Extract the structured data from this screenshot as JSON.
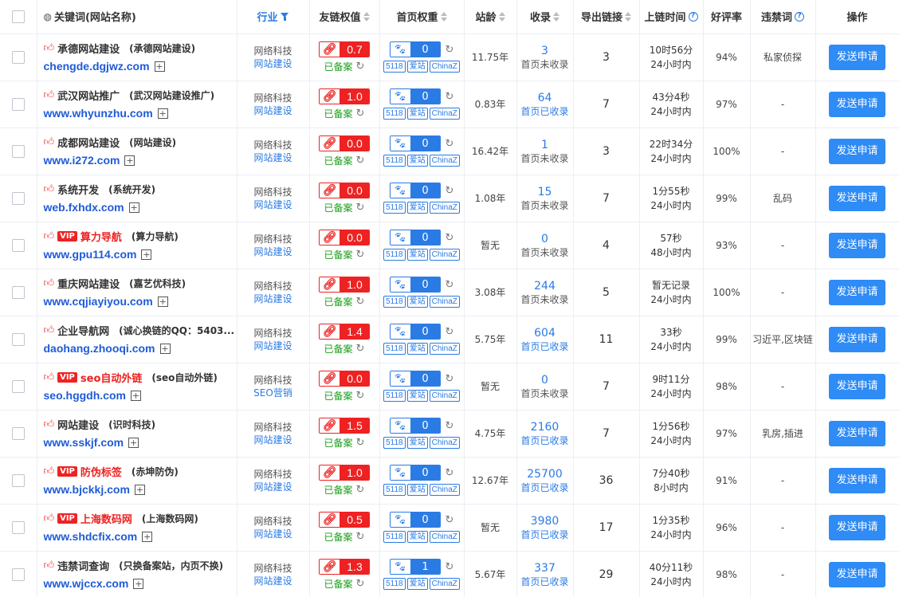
{
  "header": {
    "keyword": "关键词(网站名称)",
    "industry": "行业",
    "pr": "友链权值",
    "weight": "首页权重",
    "age": "站龄",
    "indexed": "收录",
    "outlinks": "导出链接",
    "time": "上链时间",
    "rating": "好评率",
    "banned": "违禁词",
    "action": "操作"
  },
  "labels": {
    "beian": "已备案",
    "tag_5118": "5118",
    "tag_aizhan": "爱站",
    "tag_chinaz": "ChinaZ",
    "vip": "VIP",
    "apply": "发送申请"
  },
  "rows": [
    {
      "kw": "承德网站建设",
      "sub": "(承德网站建设)",
      "vip": false,
      "domain": "chengde.dgjwz.com",
      "ind1": "网络科技",
      "ind2": "网站建设",
      "pr": "0.7",
      "weight": "0",
      "age": "11.75年",
      "sl": "3",
      "sl_status": "首页未收录",
      "sl_ok": false,
      "out": "3",
      "t1": "10时56分",
      "t2": "24小时内",
      "rate": "94%",
      "ban": "私家侦探"
    },
    {
      "kw": "武汉网站推广",
      "sub": "(武汉网站建设推广)",
      "vip": false,
      "domain": "www.whyunzhu.com",
      "ind1": "网络科技",
      "ind2": "网站建设",
      "pr": "1.0",
      "weight": "0",
      "age": "0.83年",
      "sl": "64",
      "sl_status": "首页已收录",
      "sl_ok": true,
      "out": "7",
      "t1": "43分4秒",
      "t2": "24小时内",
      "rate": "97%",
      "ban": "-"
    },
    {
      "kw": "成都网站建设",
      "sub": "(网站建设)",
      "vip": false,
      "domain": "www.i272.com",
      "ind1": "网络科技",
      "ind2": "网站建设",
      "pr": "0.0",
      "weight": "0",
      "age": "16.42年",
      "sl": "1",
      "sl_status": "首页未收录",
      "sl_ok": false,
      "out": "3",
      "t1": "22时34分",
      "t2": "24小时内",
      "rate": "100%",
      "ban": "-"
    },
    {
      "kw": "系统开发",
      "sub": "(系统开发)",
      "vip": false,
      "domain": "web.fxhdx.com",
      "ind1": "网络科技",
      "ind2": "网站建设",
      "pr": "0.0",
      "weight": "0",
      "age": "1.08年",
      "sl": "15",
      "sl_status": "首页未收录",
      "sl_ok": false,
      "out": "7",
      "t1": "1分55秒",
      "t2": "24小时内",
      "rate": "99%",
      "ban": "乱码"
    },
    {
      "kw": "算力导航",
      "sub": "(算力导航)",
      "vip": true,
      "domain": "www.gpu114.com",
      "ind1": "网络科技",
      "ind2": "网站建设",
      "pr": "0.0",
      "weight": "0",
      "age": "暂无",
      "sl": "0",
      "sl_status": "首页未收录",
      "sl_ok": false,
      "out": "4",
      "t1": "57秒",
      "t2": "48小时内",
      "rate": "93%",
      "ban": "-"
    },
    {
      "kw": "重庆网站建设",
      "sub": "(嘉艺优科技)",
      "vip": false,
      "domain": "www.cqjiayiyou.com",
      "ind1": "网络科技",
      "ind2": "网站建设",
      "pr": "1.0",
      "weight": "0",
      "age": "3.08年",
      "sl": "244",
      "sl_status": "首页未收录",
      "sl_ok": false,
      "out": "5",
      "t1": "暂无记录",
      "t2": "24小时内",
      "rate": "100%",
      "ban": "-"
    },
    {
      "kw": "企业导航网",
      "sub": "(诚心换链的QQ：5403...",
      "vip": false,
      "domain": "daohang.zhooqi.com",
      "ind1": "网络科技",
      "ind2": "网站建设",
      "pr": "1.4",
      "weight": "0",
      "age": "5.75年",
      "sl": "604",
      "sl_status": "首页已收录",
      "sl_ok": true,
      "out": "11",
      "t1": "33秒",
      "t2": "24小时内",
      "rate": "99%",
      "ban": "习近平,区块链"
    },
    {
      "kw": "seo自动外链",
      "sub": "(seo自动外链)",
      "vip": true,
      "domain": "seo.hggdh.com",
      "ind1": "网络科技",
      "ind2": "SEO营销",
      "pr": "0.0",
      "weight": "0",
      "age": "暂无",
      "sl": "0",
      "sl_status": "首页未收录",
      "sl_ok": false,
      "out": "7",
      "t1": "9时11分",
      "t2": "24小时内",
      "rate": "98%",
      "ban": "-"
    },
    {
      "kw": "网站建设",
      "sub": "(识时科技)",
      "vip": false,
      "domain": "www.sskjf.com",
      "ind1": "网络科技",
      "ind2": "网站建设",
      "pr": "1.5",
      "weight": "0",
      "age": "4.75年",
      "sl": "2160",
      "sl_status": "首页已收录",
      "sl_ok": true,
      "out": "7",
      "t1": "1分56秒",
      "t2": "24小时内",
      "rate": "97%",
      "ban": "乳房,插进"
    },
    {
      "kw": "防伪标签",
      "sub": "(赤坤防伪)",
      "vip": true,
      "domain": "www.bjckkj.com",
      "ind1": "网络科技",
      "ind2": "网站建设",
      "pr": "1.0",
      "weight": "0",
      "age": "12.67年",
      "sl": "25700",
      "sl_status": "首页已收录",
      "sl_ok": true,
      "out": "36",
      "t1": "7分40秒",
      "t2": "8小时内",
      "rate": "91%",
      "ban": "-"
    },
    {
      "kw": "上海数码网",
      "sub": "(上海数码网)",
      "vip": true,
      "domain": "www.shdcfix.com",
      "ind1": "网络科技",
      "ind2": "网站建设",
      "pr": "0.5",
      "weight": "0",
      "age": "暂无",
      "sl": "3980",
      "sl_status": "首页已收录",
      "sl_ok": true,
      "out": "17",
      "t1": "1分35秒",
      "t2": "24小时内",
      "rate": "96%",
      "ban": "-"
    },
    {
      "kw": "违禁词查询",
      "sub": "(只换备案站，内页不换)",
      "vip": false,
      "domain": "www.wjccx.com",
      "ind1": "网络科技",
      "ind2": "网站建设",
      "pr": "1.3",
      "weight": "1",
      "age": "5.67年",
      "sl": "337",
      "sl_status": "首页已收录",
      "sl_ok": true,
      "out": "29",
      "t1": "40分11秒",
      "t2": "24小时内",
      "rate": "98%",
      "ban": "-"
    }
  ]
}
